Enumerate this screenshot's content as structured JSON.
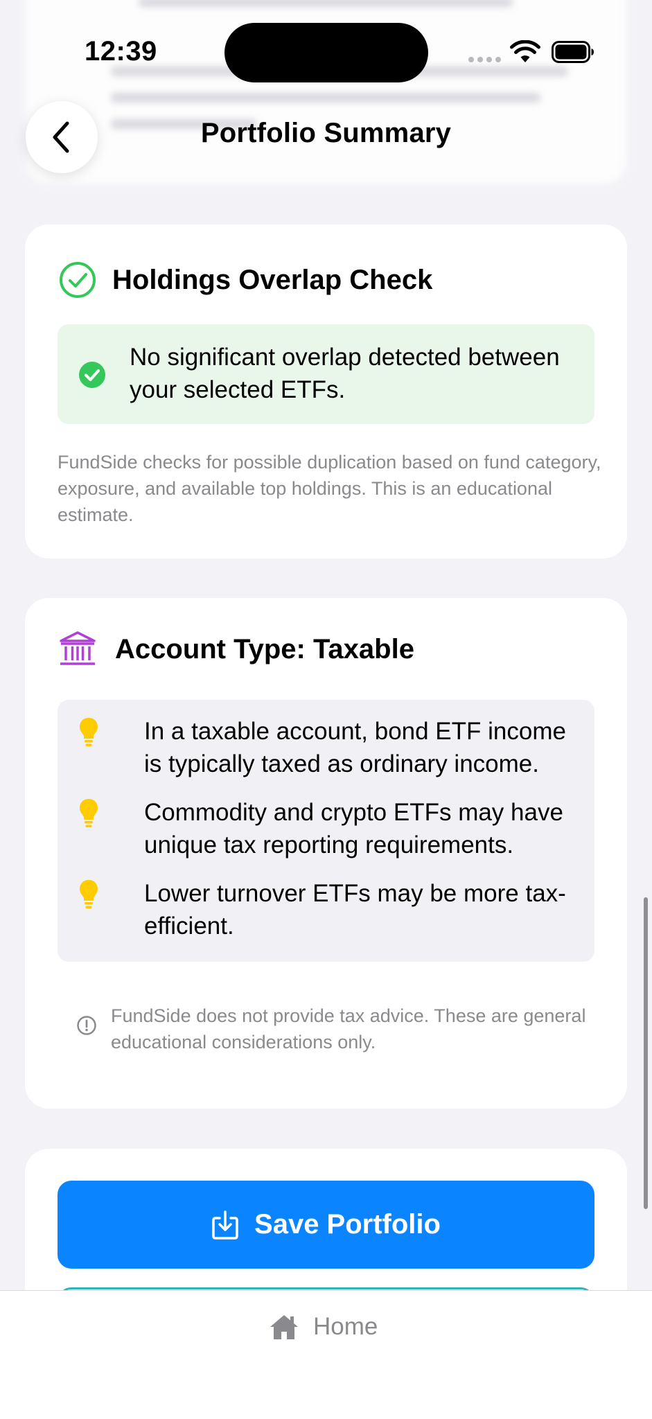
{
  "status_bar": {
    "time": "12:39"
  },
  "header": {
    "title": "Portfolio Summary",
    "back_icon": "chevron-left-icon"
  },
  "overlap_check": {
    "title": "Holdings Overlap Check",
    "title_icon": "check-circle-icon",
    "result_icon": "check-filled-icon",
    "result_message": "No significant overlap detected between your selected ETFs.",
    "note": "FundSide checks for possible duplication based on fund category, exposure, and available top holdings. This is an educational estimate."
  },
  "account_type": {
    "title": "Account Type: Taxable",
    "title_icon": "bank-icon",
    "tips": [
      {
        "icon": "lightbulb-icon",
        "text": "In a taxable account, bond ETF income is typically taxed as ordinary income."
      },
      {
        "icon": "lightbulb-icon",
        "text": "Commodity and crypto ETFs may have unique tax reporting requirements."
      },
      {
        "icon": "lightbulb-icon",
        "text": "Lower turnover ETFs may be more tax-efficient."
      }
    ],
    "disclaimer_icon": "info-icon",
    "disclaimer": "FundSide does not provide tax advice. These are general educational considerations only."
  },
  "actions": {
    "save_label": "Save Portfolio",
    "save_icon": "download-icon"
  },
  "tab_bar": {
    "home_label": "Home",
    "home_icon": "house-icon"
  },
  "colors": {
    "accent": "#0a84ff",
    "success": "#34c759",
    "success_bg": "#e8f7ea",
    "bank_icon": "#b23fd6",
    "bulb": "#ffcc00",
    "secondary_border": "#2fb3b3"
  }
}
